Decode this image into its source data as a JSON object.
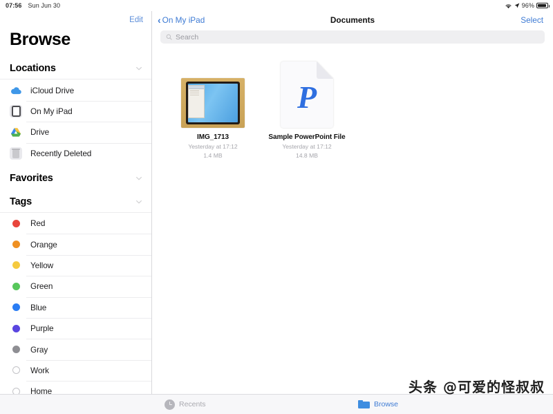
{
  "status_bar": {
    "time": "07:56",
    "date": "Sun Jun 30",
    "battery_percent": "96%",
    "wifi_icon": "wifi-icon",
    "location_icon": "location-arrow-icon",
    "battery_icon": "battery-icon"
  },
  "sidebar": {
    "edit_label": "Edit",
    "title": "Browse",
    "sections": [
      {
        "header": "Locations",
        "chevron_icon": "chevron-down-icon",
        "items": [
          {
            "label": "iCloud Drive",
            "icon": "icloud-drive-icon"
          },
          {
            "label": "On My iPad",
            "icon": "ipad-icon"
          },
          {
            "label": "Drive",
            "icon": "google-drive-icon"
          },
          {
            "label": "Recently Deleted",
            "icon": "trash-icon"
          }
        ]
      },
      {
        "header": "Favorites",
        "chevron_icon": "chevron-down-icon",
        "items": []
      },
      {
        "header": "Tags",
        "chevron_icon": "chevron-down-icon",
        "items": [
          {
            "label": "Red",
            "icon": "tag-dot-icon",
            "color": "#e8453c"
          },
          {
            "label": "Orange",
            "icon": "tag-dot-icon",
            "color": "#ef9022"
          },
          {
            "label": "Yellow",
            "icon": "tag-dot-icon",
            "color": "#f5ca3f"
          },
          {
            "label": "Green",
            "icon": "tag-dot-icon",
            "color": "#57c75b"
          },
          {
            "label": "Blue",
            "icon": "tag-dot-icon",
            "color": "#2a7df4"
          },
          {
            "label": "Purple",
            "icon": "tag-dot-icon",
            "color": "#5a46e0"
          },
          {
            "label": "Gray",
            "icon": "tag-dot-icon",
            "color": "#8e8e93"
          },
          {
            "label": "Work",
            "icon": "tag-dot-outline-icon",
            "color": ""
          },
          {
            "label": "Home",
            "icon": "tag-dot-outline-icon",
            "color": ""
          }
        ]
      }
    ]
  },
  "navbar": {
    "back_label": "On My iPad",
    "back_icon": "chevron-left-icon",
    "title": "Documents",
    "select_label": "Select"
  },
  "search": {
    "placeholder": "Search",
    "value": "",
    "icon": "search-icon"
  },
  "files": [
    {
      "name": "IMG_1713",
      "modified": "Yesterday at 17:12",
      "size": "1.4 MB",
      "icon": "photo-thumbnail"
    },
    {
      "name": "Sample PowerPoint File",
      "modified": "Yesterday at 17:12",
      "size": "14.8 MB",
      "icon": "powerpoint-document-icon"
    }
  ],
  "tabbar": {
    "recents_label": "Recents",
    "recents_icon": "clock-icon",
    "browse_label": "Browse",
    "browse_icon": "folder-icon"
  },
  "watermark": "头条 @可爱的怪叔叔",
  "colors": {
    "accent": "#3e7bd4",
    "sidebar_bg": "#ffffff",
    "tabbar_bg": "#f7f7f9",
    "search_bg": "#efeff1"
  }
}
